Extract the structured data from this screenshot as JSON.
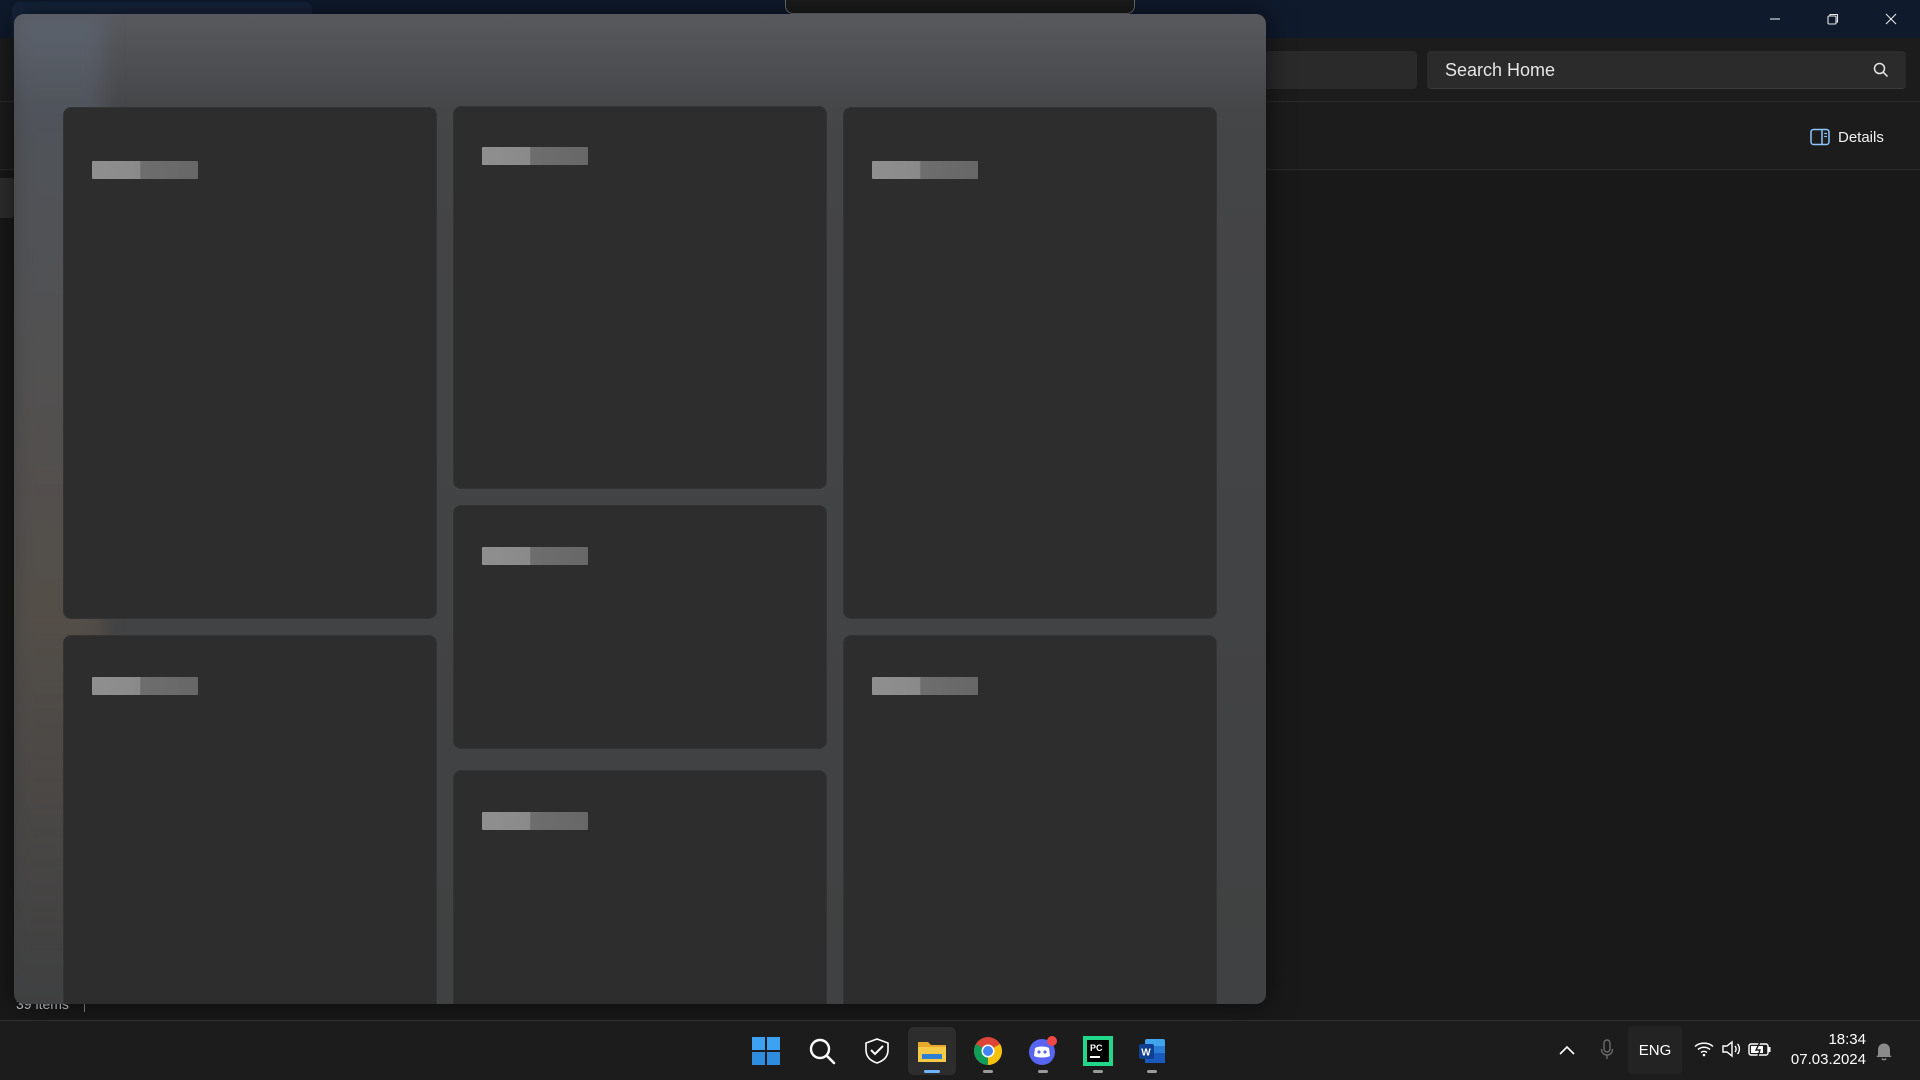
{
  "explorer": {
    "search": {
      "placeholder": "Search Home"
    },
    "command_bar": {
      "details_label": "Details"
    },
    "status": {
      "item_count": "39 items"
    }
  },
  "widgets_board": {
    "cards": [
      {
        "id": "card-1"
      },
      {
        "id": "card-2"
      },
      {
        "id": "card-3"
      },
      {
        "id": "card-4"
      },
      {
        "id": "card-5"
      },
      {
        "id": "card-6"
      },
      {
        "id": "card-7"
      }
    ]
  },
  "taskbar": {
    "apps": [
      {
        "name": "start-button",
        "icon": "windows-logo-icon",
        "active": false
      },
      {
        "name": "search-button",
        "icon": "search-icon",
        "active": false
      },
      {
        "name": "app-shield",
        "icon": "shield-app-icon",
        "active": false
      },
      {
        "name": "file-explorer",
        "icon": "folder-icon",
        "active": true
      },
      {
        "name": "chrome",
        "icon": "chrome-icon",
        "active": false
      },
      {
        "name": "discord",
        "icon": "discord-icon",
        "active": false,
        "badge": true
      },
      {
        "name": "pycharm",
        "icon": "pycharm-icon",
        "active": false
      },
      {
        "name": "word",
        "icon": "word-icon",
        "active": false
      }
    ],
    "tray": {
      "language": "ENG",
      "time": "18:34",
      "date": "07.03.2024"
    }
  },
  "colors": {
    "accent": "#6fb4ff",
    "discord_badge": "#f04747",
    "folder_yellow": "#f7c948",
    "word_blue": "#185abd",
    "pycharm_green": "#21d789"
  }
}
